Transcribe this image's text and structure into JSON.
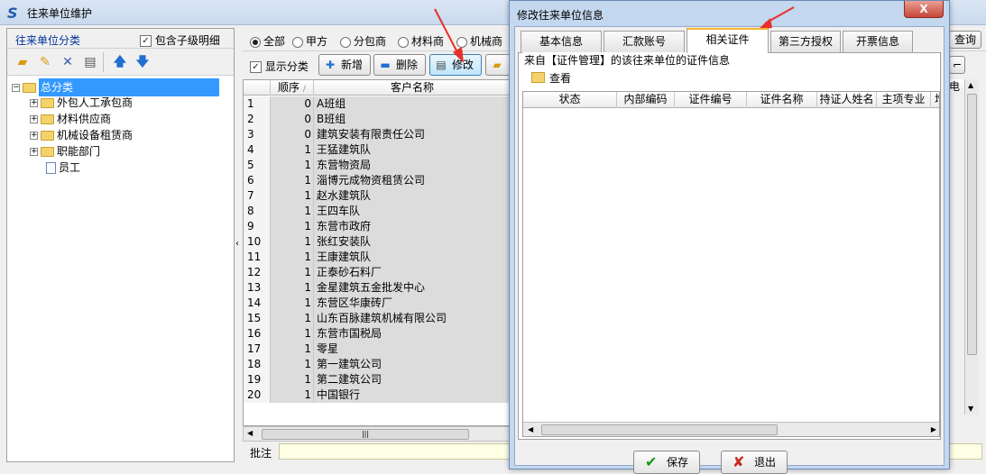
{
  "main_window": {
    "title": "往来单位维护"
  },
  "left_panel": {
    "title": "往来单位分类",
    "include_children_label": "包含子级明细",
    "tree": [
      {
        "label": "总分类",
        "level": 0,
        "expanded": true,
        "selected": true,
        "icon": "folder-open-icon"
      },
      {
        "label": "外包人工承包商",
        "level": 1,
        "expanded": false,
        "icon": "folder-icon"
      },
      {
        "label": "材料供应商",
        "level": 1,
        "expanded": false,
        "icon": "folder-icon"
      },
      {
        "label": "机械设备租赁商",
        "level": 1,
        "expanded": false,
        "icon": "folder-icon"
      },
      {
        "label": "职能部门",
        "level": 1,
        "expanded": false,
        "icon": "folder-icon"
      },
      {
        "label": "员工",
        "level": 1,
        "leaf": true,
        "icon": "document-icon"
      }
    ]
  },
  "filter": {
    "options": [
      "全部",
      "甲方",
      "分包商",
      "材料商",
      "机械商"
    ],
    "selected": "全部"
  },
  "actions": {
    "show_category_label": "显示分类",
    "add_label": "新增",
    "delete_label": "删除",
    "edit_label": "修改"
  },
  "grid": {
    "columns": [
      "顺序",
      "客户名称"
    ],
    "rows": [
      {
        "n": "1",
        "order": "0",
        "name": "A班组"
      },
      {
        "n": "2",
        "order": "0",
        "name": "B班组"
      },
      {
        "n": "3",
        "order": "0",
        "name": "建筑安装有限责任公司"
      },
      {
        "n": "4",
        "order": "1",
        "name": "王猛建筑队"
      },
      {
        "n": "5",
        "order": "1",
        "name": "东营物资局"
      },
      {
        "n": "6",
        "order": "1",
        "name": "淄博元成物资租赁公司"
      },
      {
        "n": "7",
        "order": "1",
        "name": "赵水建筑队"
      },
      {
        "n": "8",
        "order": "1",
        "name": "王四车队"
      },
      {
        "n": "9",
        "order": "1",
        "name": "东营市政府"
      },
      {
        "n": "10",
        "order": "1",
        "name": "张红安装队"
      },
      {
        "n": "11",
        "order": "1",
        "name": "王康建筑队"
      },
      {
        "n": "12",
        "order": "1",
        "name": "正泰砂石料厂"
      },
      {
        "n": "13",
        "order": "1",
        "name": "金星建筑五金批发中心"
      },
      {
        "n": "14",
        "order": "1",
        "name": "东营区华康砖厂"
      },
      {
        "n": "15",
        "order": "1",
        "name": "山东百脉建筑机械有限公司"
      },
      {
        "n": "16",
        "order": "1",
        "name": "东营市国税局"
      },
      {
        "n": "17",
        "order": "1",
        "name": "零星"
      },
      {
        "n": "18",
        "order": "1",
        "name": "第一建筑公司"
      },
      {
        "n": "19",
        "order": "1",
        "name": "第二建筑公司"
      },
      {
        "n": "20",
        "order": "1",
        "name": "中国银行"
      }
    ]
  },
  "note": {
    "label": "批注"
  },
  "right_edge": {
    "search_label": "查询",
    "column_fragment": "电"
  },
  "dialog": {
    "title": "修改往来单位信息",
    "close_label": "X",
    "tabs": [
      "基本信息",
      "汇款账号",
      "相关证件",
      "第三方授权",
      "开票信息"
    ],
    "selected_tab": "相关证件",
    "caption": "来自【证件管理】的该往来单位的证件信息",
    "view_label": "查看",
    "columns": [
      "状态",
      "内部编码",
      "证件编号",
      "证件名称",
      "持证人姓名",
      "主项专业",
      "增"
    ],
    "save_label": "保存",
    "exit_label": "退出"
  },
  "colors": {
    "selected_tree_bg": "#3399ff",
    "arrow": "#e8302a",
    "note_bg": "#ffffe6"
  }
}
